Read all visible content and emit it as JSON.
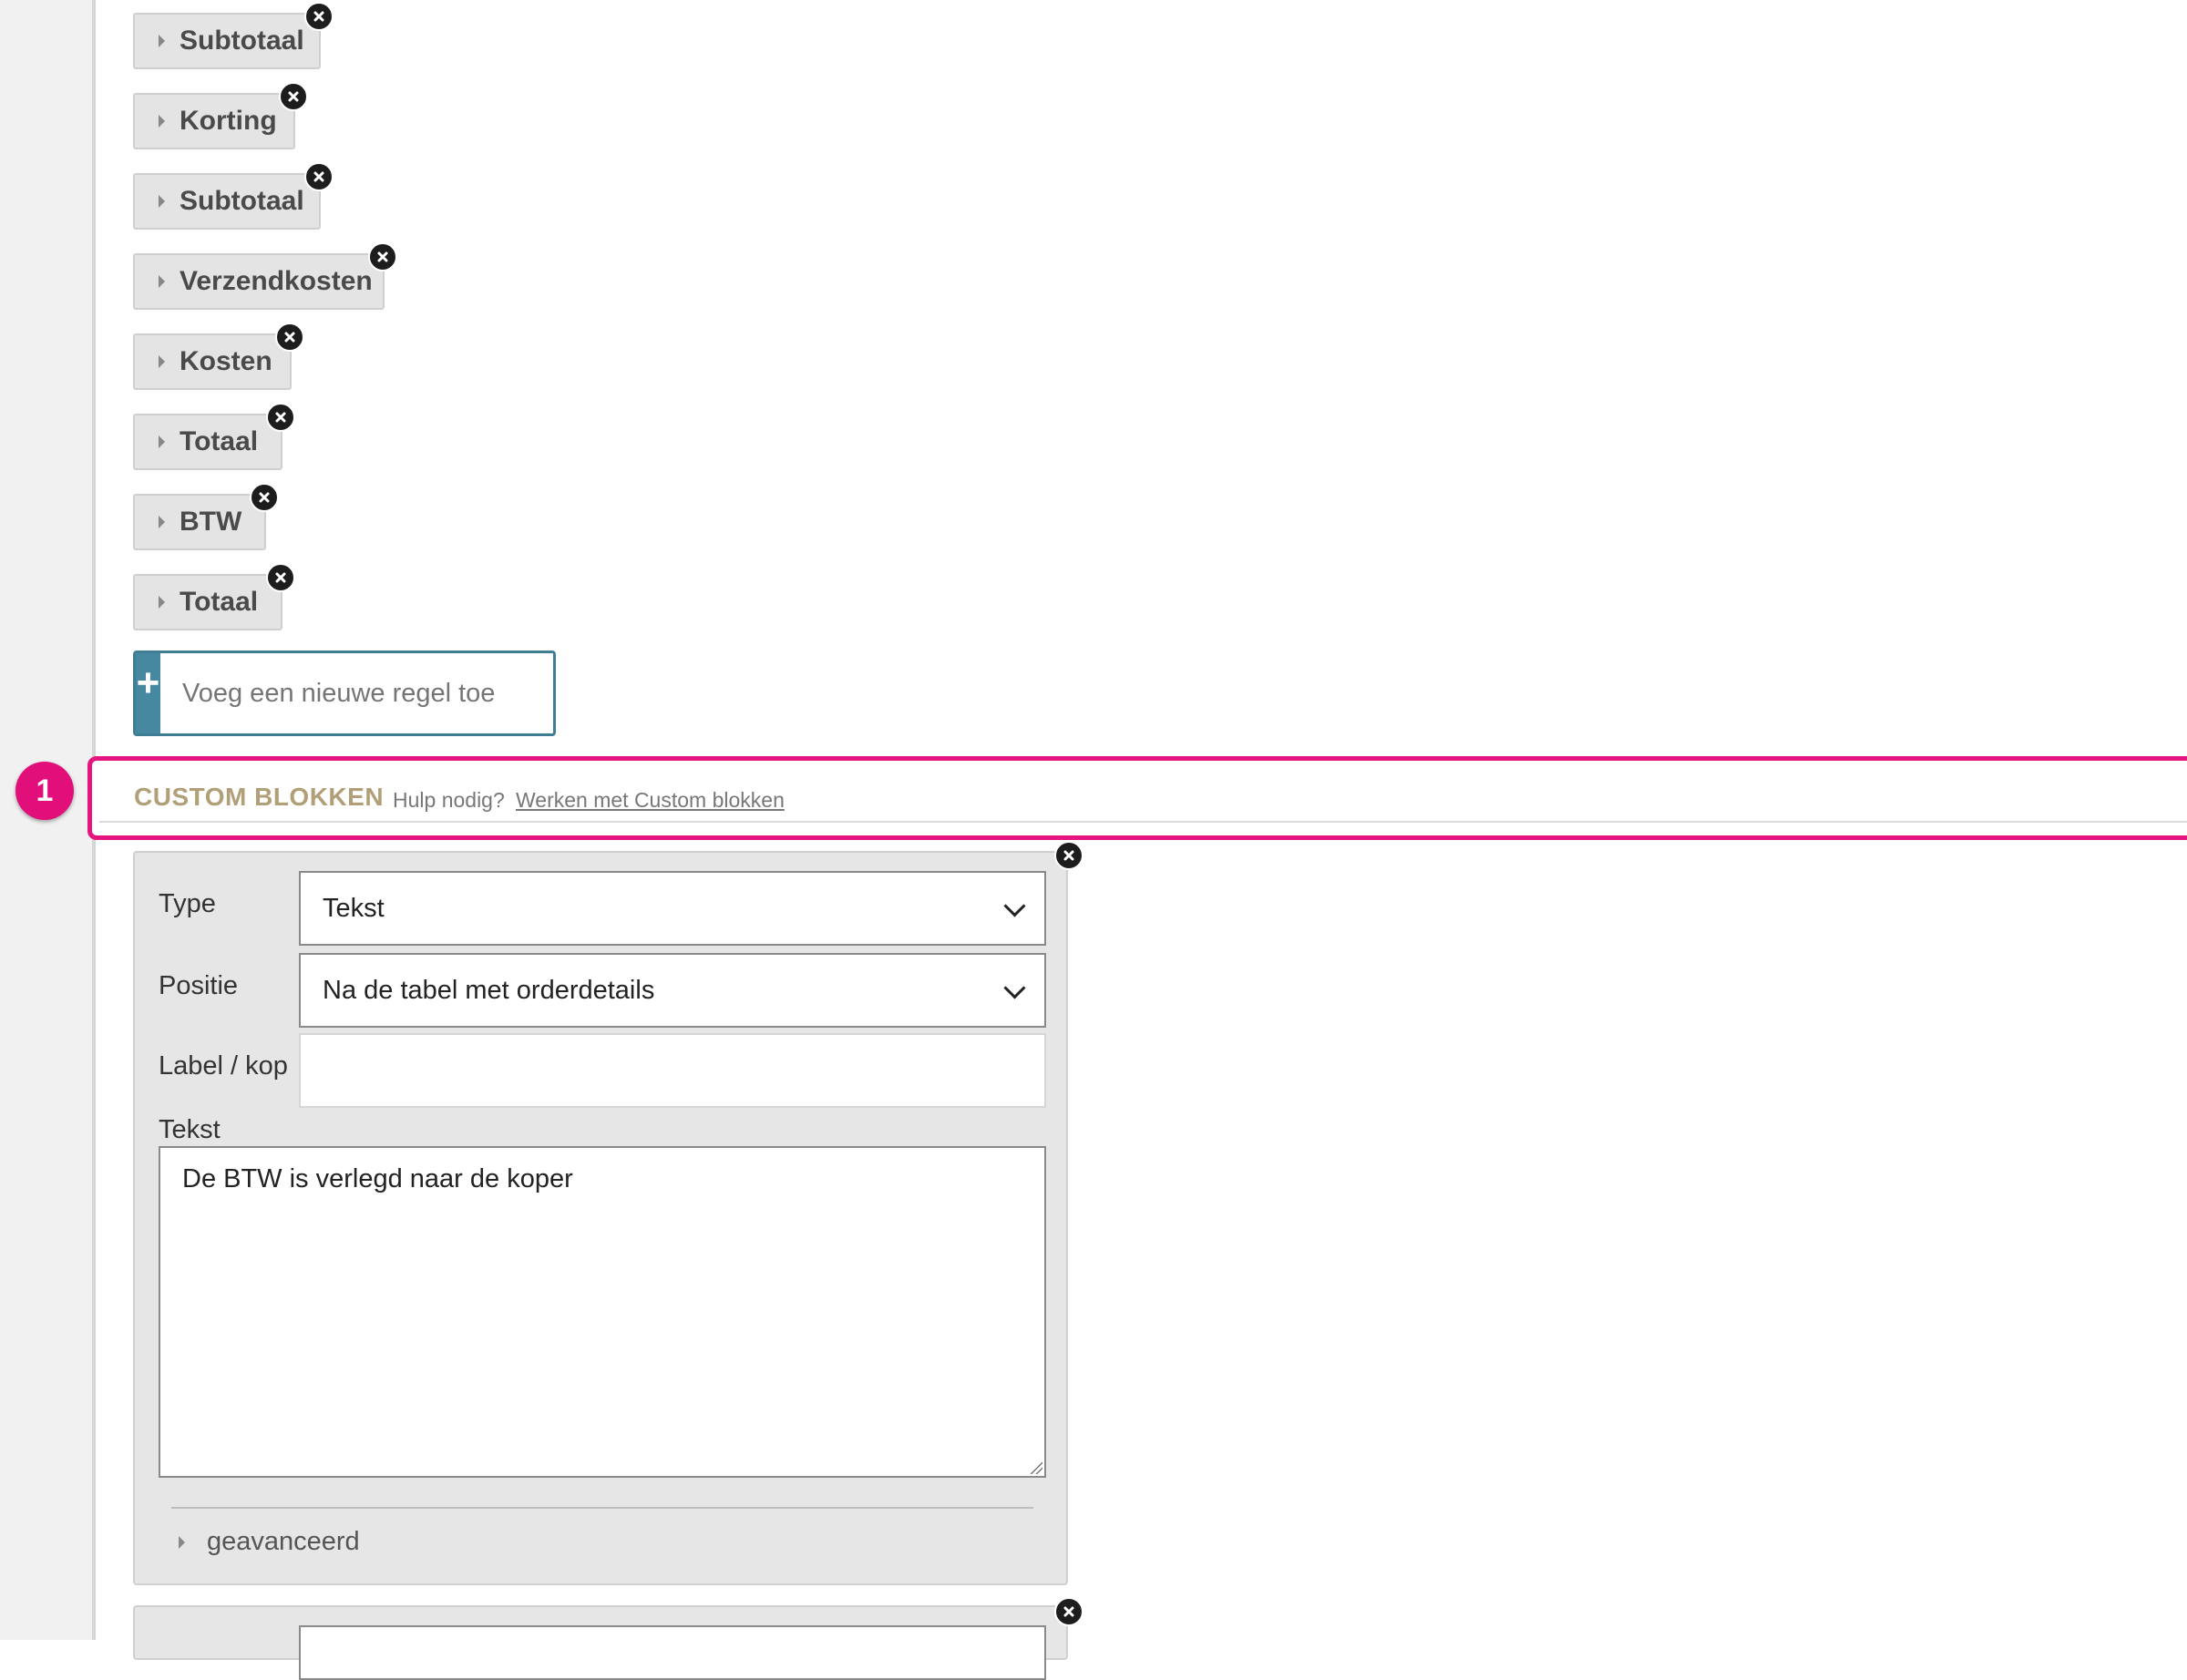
{
  "totals": [
    {
      "label": "Subtotaal"
    },
    {
      "label": "Korting"
    },
    {
      "label": "Subtotaal"
    },
    {
      "label": "Verzendkosten"
    },
    {
      "label": "Kosten"
    },
    {
      "label": "Totaal"
    },
    {
      "label": "BTW"
    },
    {
      "label": "Totaal"
    }
  ],
  "add_row": {
    "icon": "plus-icon",
    "symbol": "+",
    "placeholder": "Voeg een nieuwe regel toe"
  },
  "section": {
    "title": "CUSTOM BLOKKEN",
    "help_text": "Hulp nodig?",
    "help_link": "Werken met Custom blokken",
    "step_number": "1",
    "highlight_color": "#e4157f"
  },
  "custom_block": {
    "type_label": "Type",
    "type_value": "Tekst",
    "position_label": "Positie",
    "position_value": "Na de tabel met orderdetails",
    "heading_label": "Label / kop",
    "heading_value": "",
    "text_label": "Tekst",
    "text_value": "De BTW is verlegd naar de koper",
    "advanced_label": "geavanceerd"
  },
  "colors": {
    "accent": "#4588a0",
    "section_title": "#b19f77",
    "step_badge": "#e20e7a"
  }
}
